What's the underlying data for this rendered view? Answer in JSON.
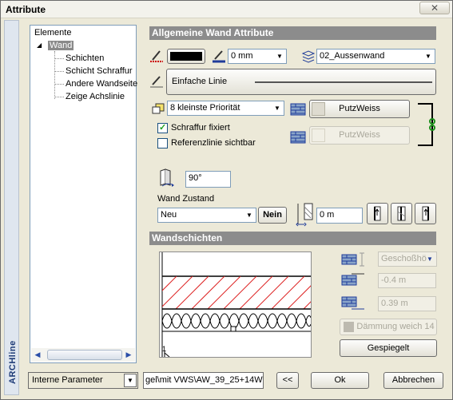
{
  "window": {
    "title": "Attribute",
    "close_glyph": "✕",
    "side_label": "ARCHline"
  },
  "tree": {
    "root": "Elemente",
    "selected": "Wand",
    "children": [
      "Schichten",
      "Schicht Schraffur",
      "Andere Wandseite",
      "Zeige Achslinie"
    ]
  },
  "general": {
    "header": "Allgemeine Wand Attribute",
    "pen_width": "0 mm",
    "layer": "02_Aussenwand",
    "line_type": "Einfache Linie",
    "priority": "8 kleinste Priorität",
    "fill_button": "PutzWeiss",
    "fill_button_2": "PutzWeiss",
    "hatch_fixed_label": "Schraffur fixiert",
    "hatch_fixed": true,
    "refline_visible_label": "Referenzlinie sichtbar",
    "refline_visible": false,
    "angle": "90°",
    "state_label": "Wand Zustand",
    "state": "Neu",
    "state_button": "Nein",
    "thickness": "0 m",
    "colors": {
      "pen": "#000000",
      "accent_red": "#cc0000",
      "accent_blue": "#1f3c9a",
      "link_green": "#1a8f1a"
    }
  },
  "layers": {
    "header": "Wandschichten",
    "level_combo": "Geschoßhö",
    "top_offset": "-0.4 m",
    "bottom_offset": "0.39 m",
    "insulation_button": "Dämmung weich 14",
    "mirror_button": "Gespiegelt",
    "preview_corner": "1"
  },
  "bottom": {
    "param_combo": "Interne Parameter",
    "path_field": "gel\\mit VWS\\AW_39_25+14W",
    "back_button": "<<",
    "ok_button": "Ok",
    "cancel_button": "Abbrechen"
  }
}
